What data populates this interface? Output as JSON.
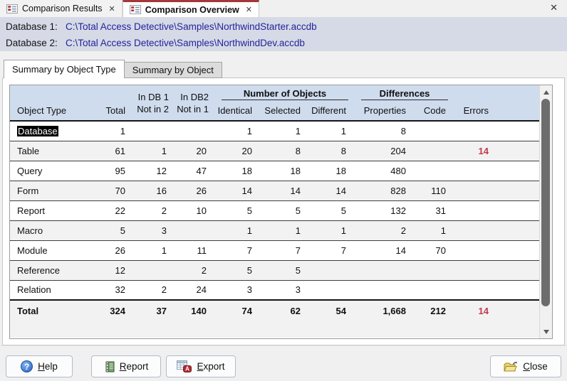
{
  "window": {
    "close_glyph": "✕"
  },
  "doc_tabs": {
    "results": {
      "label": "Comparison Results",
      "close_glyph": "✕"
    },
    "overview": {
      "label": "Comparison Overview",
      "close_glyph": "✕"
    }
  },
  "databases": {
    "db1": {
      "label": "Database 1:",
      "path": "C:\\Total Access Detective\\Samples\\NorthwindStarter.accdb"
    },
    "db2": {
      "label": "Database 2:",
      "path": "C:\\Total Access Detective\\Samples\\NorthwindDev.accdb"
    }
  },
  "view_tabs": {
    "by_object_type": "Summary by Object Type",
    "by_object": "Summary by Object"
  },
  "table": {
    "headers": {
      "object_type": "Object Type",
      "total": "Total",
      "in_db1_line1": "In DB 1",
      "in_db1_line2": "Not in 2",
      "in_db2_line1": "In DB2",
      "in_db2_line2": "Not in 1",
      "number_of_objects_group": "Number of Objects",
      "identical": "Identical",
      "selected": "Selected",
      "different": "Different",
      "differences_group": "Differences",
      "properties": "Properties",
      "code": "Code",
      "errors": "Errors"
    },
    "rows": [
      {
        "object_type": "Database",
        "selected": true,
        "values": [
          "1",
          "",
          "",
          "1",
          "1",
          "1",
          "8",
          "",
          ""
        ]
      },
      {
        "object_type": "Table",
        "values": [
          "61",
          "1",
          "20",
          "20",
          "8",
          "8",
          "204",
          "",
          "14"
        ]
      },
      {
        "object_type": "Query",
        "values": [
          "95",
          "12",
          "47",
          "18",
          "18",
          "18",
          "480",
          "",
          ""
        ]
      },
      {
        "object_type": "Form",
        "values": [
          "70",
          "16",
          "26",
          "14",
          "14",
          "14",
          "828",
          "110",
          ""
        ]
      },
      {
        "object_type": "Report",
        "values": [
          "22",
          "2",
          "10",
          "5",
          "5",
          "5",
          "132",
          "31",
          ""
        ]
      },
      {
        "object_type": "Macro",
        "values": [
          "5",
          "3",
          "",
          "1",
          "1",
          "1",
          "2",
          "1",
          ""
        ]
      },
      {
        "object_type": "Module",
        "values": [
          "26",
          "1",
          "11",
          "7",
          "7",
          "7",
          "14",
          "70",
          ""
        ]
      },
      {
        "object_type": "Reference",
        "values": [
          "12",
          "",
          "2",
          "5",
          "5",
          "",
          "",
          "",
          ""
        ]
      },
      {
        "object_type": "Relation",
        "values": [
          "32",
          "2",
          "24",
          "3",
          "3",
          "",
          "",
          "",
          ""
        ]
      }
    ],
    "total_row": {
      "object_type": "Total",
      "values": [
        "324",
        "37",
        "140",
        "74",
        "62",
        "54",
        "1,668",
        "212",
        "14"
      ]
    }
  },
  "buttons": {
    "help": {
      "hotkey": "H",
      "rest": "elp"
    },
    "report": {
      "hotkey": "R",
      "rest": "eport"
    },
    "export": {
      "hotkey": "E",
      "rest": "xport"
    },
    "close": {
      "hotkey": "C",
      "rest": "lose"
    }
  },
  "colors": {
    "accent_maroon": "#a4373a",
    "header_blue": "#cfdcee",
    "total_blue": "#c5d5ee",
    "error_red": "#c0394b",
    "path_navy": "#23239b",
    "db_strip": "#d5dae6"
  }
}
